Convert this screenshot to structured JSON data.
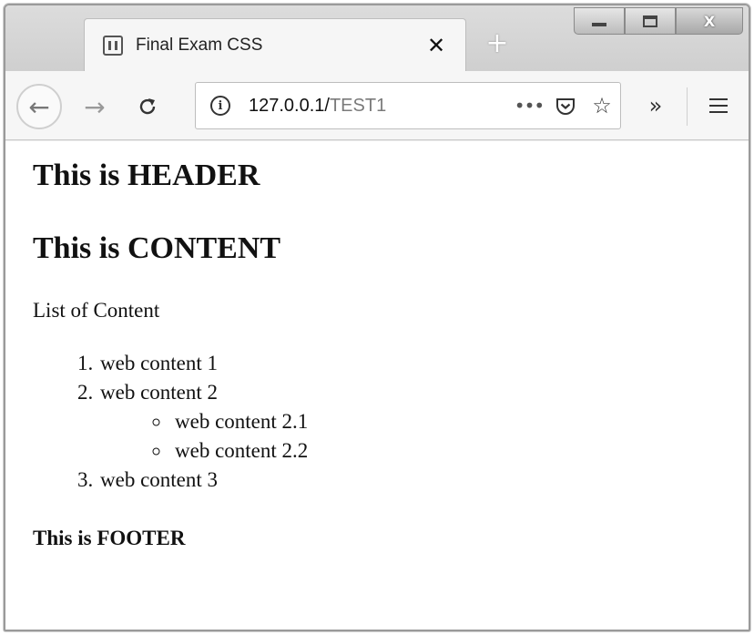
{
  "browser": {
    "tab": {
      "title": "Final Exam CSS",
      "close_glyph": "✕"
    },
    "new_tab_glyph": "+",
    "window_controls": {
      "close_glyph": "X"
    },
    "nav": {
      "back_glyph": "←",
      "forward_glyph": "→",
      "reload_glyph": "C",
      "overflow_glyph": "»"
    },
    "address": {
      "host": "127.0.0.1/",
      "path": "TEST1",
      "more_glyph": "•••",
      "star_glyph": "☆"
    },
    "icons": [
      "favicon-icon",
      "close-icon",
      "plus-icon",
      "back-icon",
      "forward-icon",
      "reload-icon",
      "info-icon",
      "more-icon",
      "pocket-icon",
      "star-icon",
      "overflow-icon",
      "menu-icon"
    ]
  },
  "page": {
    "header": "This is HEADER",
    "content_title": "This is CONTENT",
    "list_label": "List of Content",
    "list": [
      {
        "label": "web content 1"
      },
      {
        "label": "web content 2",
        "children": [
          "web content 2.1",
          "web content 2.2"
        ]
      },
      {
        "label": "web content 3"
      }
    ],
    "footer": "This is FOOTER"
  }
}
